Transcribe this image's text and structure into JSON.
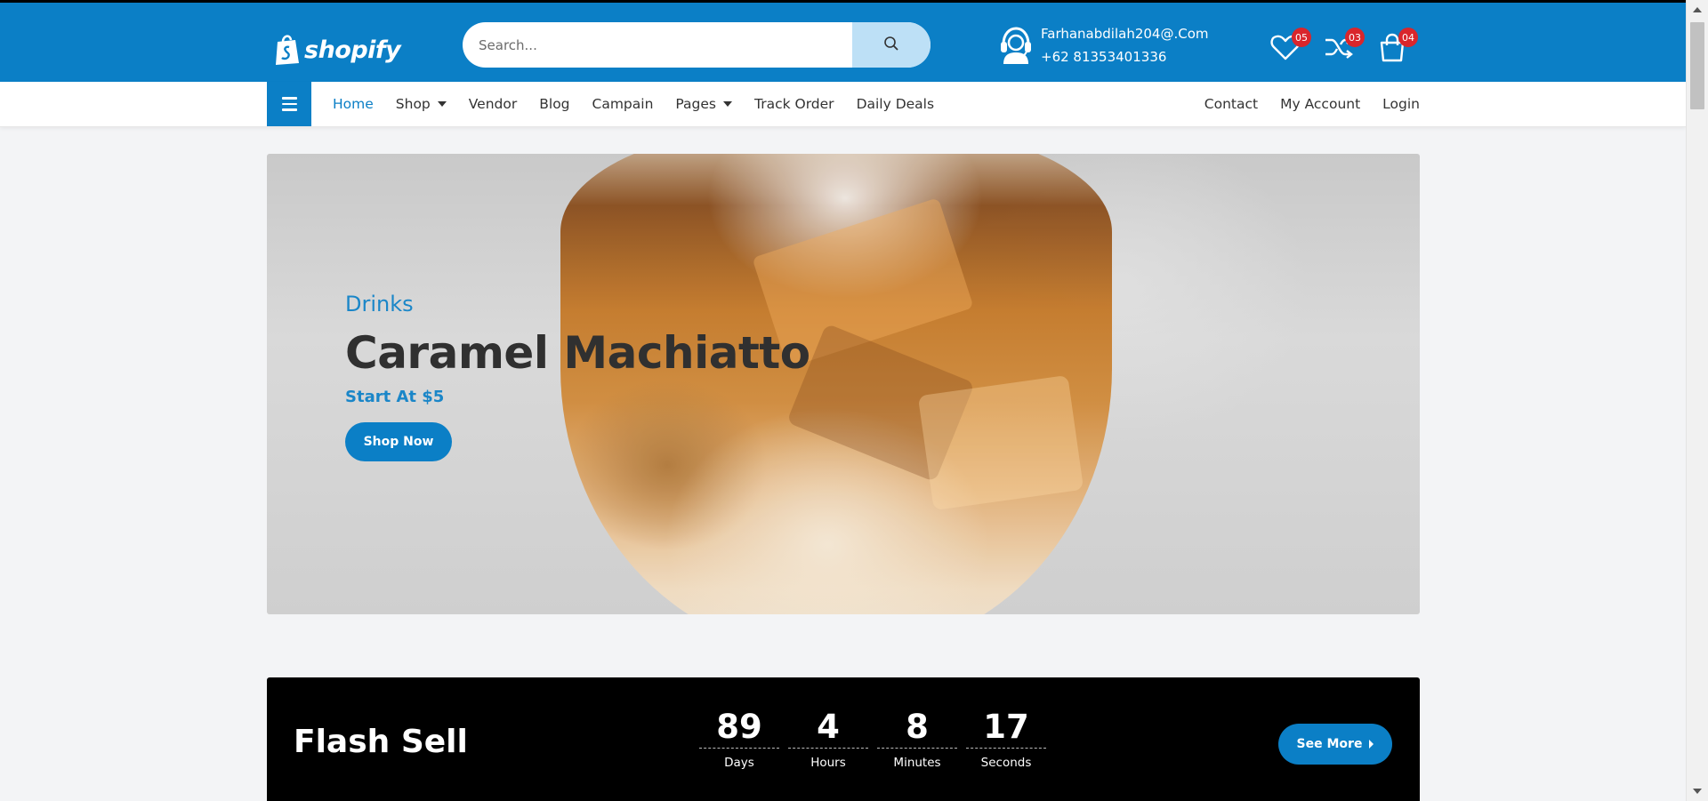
{
  "brand": {
    "name": "shopify",
    "logo_icon": "shopping-bag-icon"
  },
  "search": {
    "placeholder": "Search...",
    "icon": "search-icon"
  },
  "contact": {
    "email": "Farhanabdilah204@.Com",
    "phone": "+62 81353401336",
    "icon": "headset-support-icon"
  },
  "header_icons": [
    {
      "name": "wishlist",
      "icon": "heart-icon",
      "count": "05"
    },
    {
      "name": "compare",
      "icon": "shuffle-icon",
      "count": "03"
    },
    {
      "name": "cart",
      "icon": "shopping-bag-icon",
      "count": "04"
    }
  ],
  "nav": {
    "menu_icon": "hamburger-menu-icon",
    "left": [
      "Home",
      "Shop",
      "Vendor",
      "Blog",
      "Campain",
      "Pages",
      "Track Order",
      "Daily Deals"
    ],
    "right": [
      "Contact",
      "My Account",
      "Login"
    ]
  },
  "hero": {
    "category": "Drinks",
    "title": "Caramel Machiatto",
    "price_text": "Start At $5",
    "button": "Shop Now"
  },
  "flash": {
    "title": "Flash Sell",
    "countdown": [
      {
        "value": "89",
        "label": "Days"
      },
      {
        "value": "4",
        "label": "Hours"
      },
      {
        "value": "8",
        "label": "Minutes"
      },
      {
        "value": "17",
        "label": "Seconds"
      }
    ],
    "button": "See More"
  },
  "colors": {
    "primary": "#0b7fc6",
    "badge": "#d9262c",
    "accent_text": "#1a86c8"
  }
}
